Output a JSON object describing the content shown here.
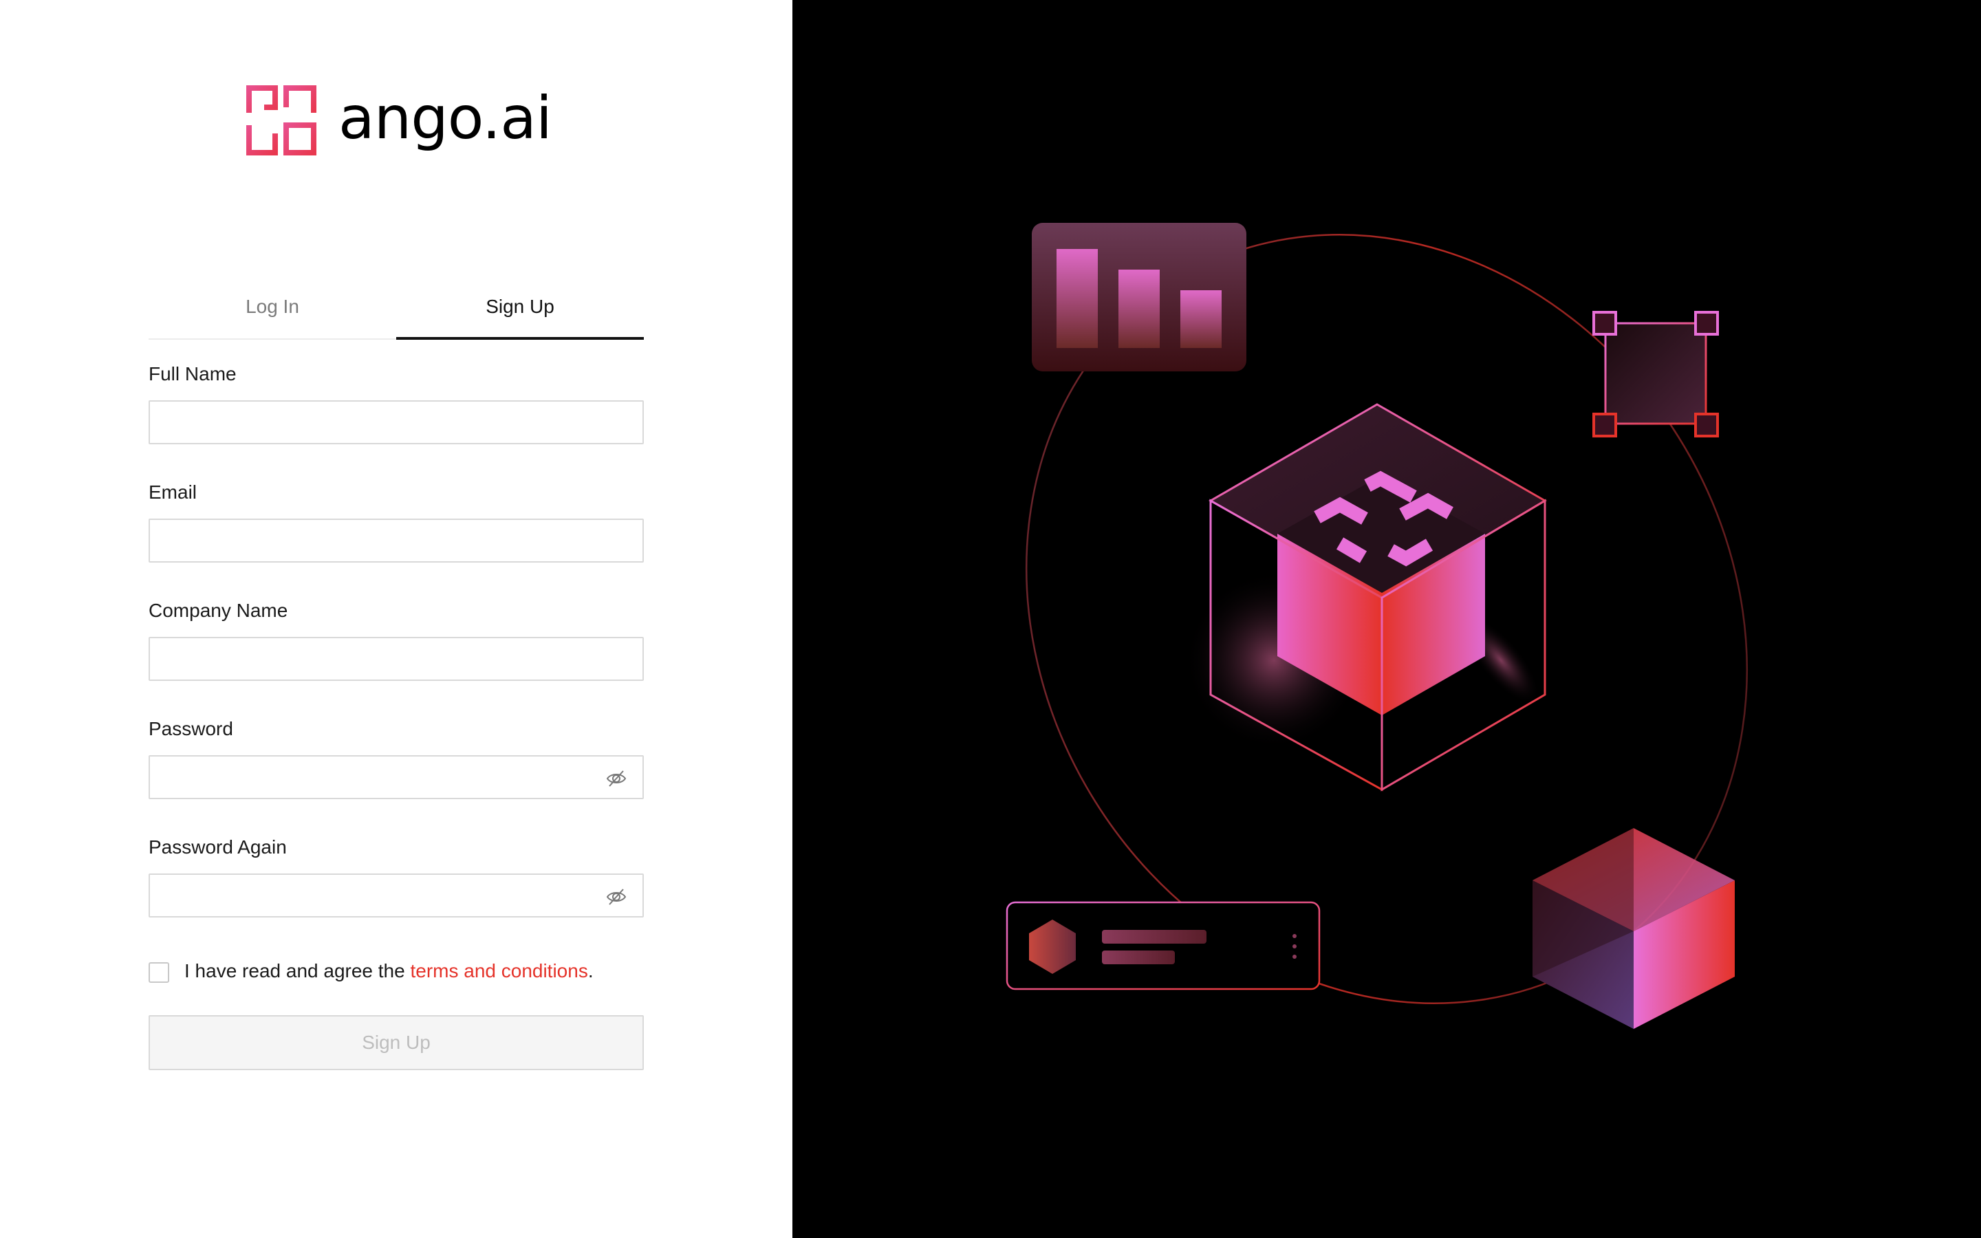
{
  "brand": {
    "name": "ango.ai",
    "mark_icon": "ango-grid-logo-icon",
    "accent": "#e8457a"
  },
  "tabs": [
    {
      "label": "Log In",
      "active": false
    },
    {
      "label": "Sign Up",
      "active": true
    }
  ],
  "form": {
    "fields": [
      {
        "label": "Full Name",
        "value": "",
        "type": "text"
      },
      {
        "label": "Email",
        "value": "",
        "type": "email"
      },
      {
        "label": "Company Name",
        "value": "",
        "type": "text"
      },
      {
        "label": "Password",
        "value": "",
        "type": "password",
        "icon": "eye-hidden-icon"
      },
      {
        "label": "Password Again",
        "value": "",
        "type": "password",
        "icon": "eye-hidden-icon"
      }
    ],
    "agree": {
      "checked": false,
      "prefix": "I have read and agree the ",
      "link": "terms and conditions",
      "suffix": "."
    },
    "submit_label": "Sign Up",
    "submit_disabled": true
  },
  "colors": {
    "link": "#e5332a",
    "panel_bg": "#000000",
    "pink": "#e879d8",
    "red": "#e5332a"
  }
}
